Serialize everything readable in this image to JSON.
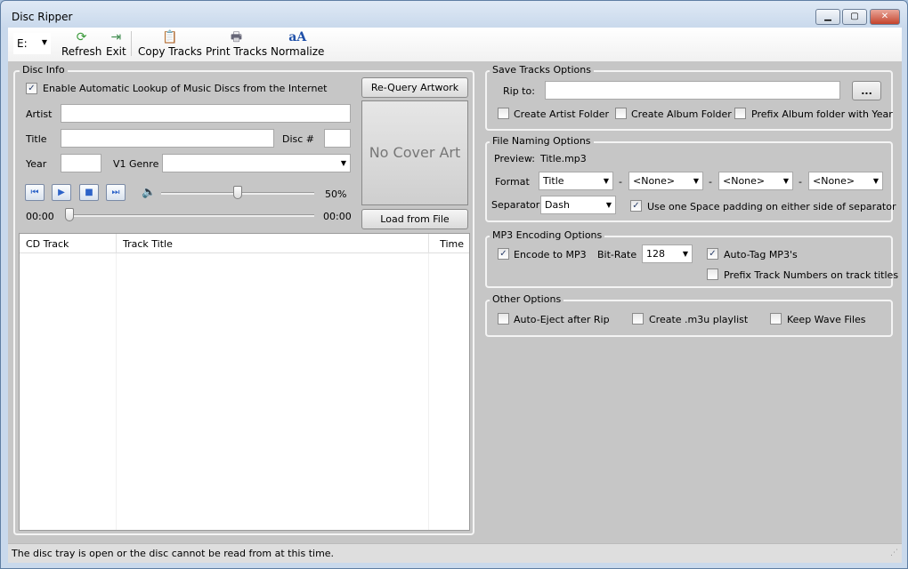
{
  "window": {
    "title": "Disc Ripper",
    "controls": [
      "minimize",
      "maximize",
      "close"
    ]
  },
  "toolbar": {
    "drive": "E:",
    "refresh": "Refresh",
    "exit": "Exit",
    "copy": "Copy Tracks",
    "print": "Print Tracks",
    "normalize": "Normalize"
  },
  "disc_info": {
    "legend": "Disc Info",
    "auto_lookup": "Enable Automatic Lookup of Music Discs from the Internet",
    "auto_lookup_checked": true,
    "artist_label": "Artist",
    "artist": "",
    "title_label": "Title",
    "title": "",
    "disc_label": "Disc #",
    "disc": "",
    "year_label": "Year",
    "year": "",
    "genre_label": "V1 Genre",
    "genre": "",
    "requery": "Re-Query Artwork",
    "no_cover": "No Cover Art",
    "load_file": "Load from File",
    "volume": "50%",
    "volume_value": 50,
    "time_start": "00:00",
    "time_end": "00:00",
    "position_value": 0
  },
  "tracks": {
    "columns": [
      "CD Track",
      "Track Title",
      "Time"
    ],
    "rows": []
  },
  "save": {
    "legend": "Save Tracks Options",
    "rip_label": "Rip to:",
    "rip_to": "",
    "browse": "...",
    "artist_folder": "Create Artist Folder",
    "album_folder": "Create Album Folder",
    "prefix_year": "Prefix Album folder with Year"
  },
  "naming": {
    "legend": "File Naming Options",
    "preview_label": "Preview:",
    "preview": "Title.mp3",
    "format_label": "Format",
    "format": [
      "Title",
      "<None>",
      "<None>",
      "<None>"
    ],
    "dash": "-",
    "separator_label": "Separator",
    "separator": "Dash",
    "padding": "Use one Space padding on either side of separator",
    "padding_checked": true
  },
  "mp3": {
    "legend": "MP3 Encoding Options",
    "encode": "Encode to MP3",
    "encode_checked": true,
    "bitrate_label": "Bit-Rate",
    "bitrate": "128",
    "autotag": "Auto-Tag MP3's",
    "autotag_checked": true,
    "prefix_numbers": "Prefix Track Numbers on track titles"
  },
  "other": {
    "legend": "Other Options",
    "eject": "Auto-Eject after Rip",
    "m3u": "Create .m3u playlist",
    "wave": "Keep Wave Files"
  },
  "status": "The disc tray is open or the disc cannot be read from at this time."
}
